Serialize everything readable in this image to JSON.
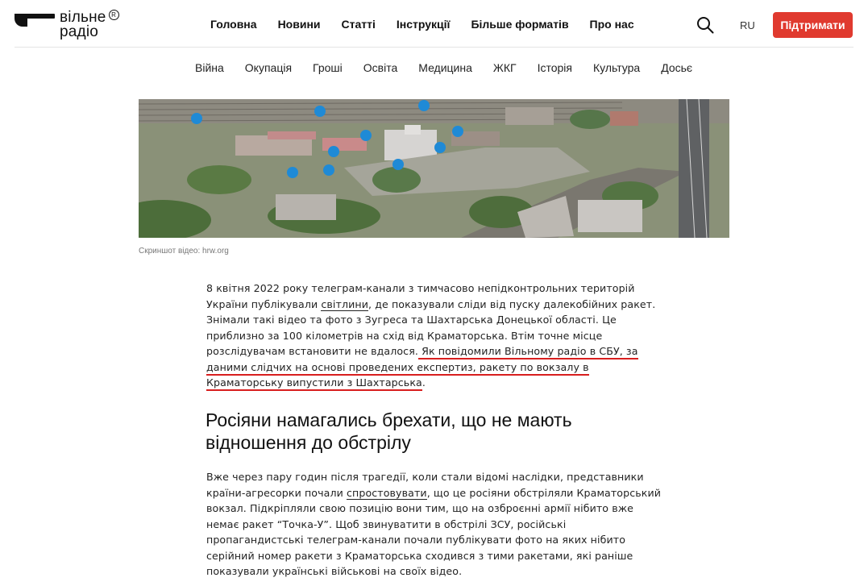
{
  "logo": {
    "line1": "вільне",
    "line2": "радіо",
    "reg": "R"
  },
  "nav": {
    "items": [
      "Головна",
      "Новини",
      "Статті",
      "Інструкції",
      "Більше форматів",
      "Про нас"
    ]
  },
  "lang": "RU",
  "support_label": "Підтримати",
  "categories": [
    "Війна",
    "Окупація",
    "Гроші",
    "Освіта",
    "Медицина",
    "ЖКГ",
    "Історія",
    "Культура",
    "Досьє"
  ],
  "image": {
    "caption": "Скриншот відео: hrw.org"
  },
  "article": {
    "p1": {
      "t1": "8 квітня 2022 року телеграм-канали з тимчасово непідконтрольних територій України публікували ",
      "link1": "світлини",
      "t2": ", де показували сліди від пуску далекобійних ракет. Знімали такі відео та фото з Зугреса та Шахтарська Донецької області. Це приблизно за 100 кілометрів на схід від Краматорська. Втім точне місце розслідувачам встановити не вдалося.",
      "hl1": " Як повідомили Вільному радіо в СБУ, за даними слідчих на основі проведених експертиз, ",
      "link2": "ракету по вокзалу в Краматорську випустили з Шахтарська",
      "t3": "."
    },
    "h2": "Росіяни намагались брехати, що не мають відношення до обстрілу",
    "p2": {
      "t1": "Вже через пару годин після трагедії, коли стали відомі наслідки, представники країни-агресорки почали ",
      "link1": "спростовувати",
      "t2": ", що це росіяни обстріляли Краматорський вокзал. Підкріпляли свою позицію вони тим, що на озброєнні армії нібито вже немає ракет “Точка-У”. Щоб звинуватити в обстрілі ЗСУ, російські пропагандистські телеграм-канали почали публікувати фото на яких нібито серійний номер ракети з Краматорська сходився з тими ракетами, які раніше показували українські військові на своїх відео."
    }
  },
  "colors": {
    "accent": "#e03a2f",
    "highlight": "#d81e1e",
    "marker": "#1f8ad6"
  }
}
